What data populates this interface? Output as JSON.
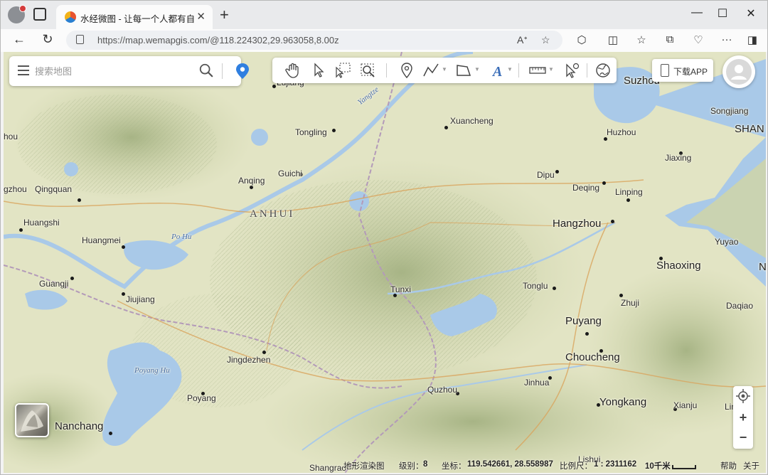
{
  "browser": {
    "tab_title": "水经微图 - 让每一个人都有自己的",
    "url": "https://map.wemapgis.com/@118.224302,29.963058,8.00z"
  },
  "search": {
    "placeholder": "搜索地图"
  },
  "download": {
    "label": "下载APP"
  },
  "map_labels": {
    "places": [
      {
        "name": "Lujiang"
      },
      {
        "name": "Tongling"
      },
      {
        "name": "Xuancheng"
      },
      {
        "name": "Suzhou"
      },
      {
        "name": "Huzhou"
      },
      {
        "name": "Songjiang"
      },
      {
        "name": "SHAN"
      },
      {
        "name": "Jiaxing"
      },
      {
        "name": "Guichi"
      },
      {
        "name": "Anqing"
      },
      {
        "name": "Dipu"
      },
      {
        "name": "Deqing"
      },
      {
        "name": "Linping"
      },
      {
        "name": "Qingquan"
      },
      {
        "name": "gzhou"
      },
      {
        "name": "hou"
      },
      {
        "name": "Huangshi"
      },
      {
        "name": "Huangmei"
      },
      {
        "name": "Hangzhou"
      },
      {
        "name": "Yuyao"
      },
      {
        "name": "Shaoxing"
      },
      {
        "name": "N"
      },
      {
        "name": "Guangji"
      },
      {
        "name": "Tunxi"
      },
      {
        "name": "Tonglu"
      },
      {
        "name": "Jiujiang"
      },
      {
        "name": "Zhuji"
      },
      {
        "name": "Daqiao"
      },
      {
        "name": "Puyang"
      },
      {
        "name": "Jingdezhen"
      },
      {
        "name": "Choucheng"
      },
      {
        "name": "Jinhua"
      },
      {
        "name": "Quzhou"
      },
      {
        "name": "Poyang"
      },
      {
        "name": "Yongkang"
      },
      {
        "name": "Xianju"
      },
      {
        "name": "Linhai"
      },
      {
        "name": "Nanchang"
      },
      {
        "name": "Lishui"
      },
      {
        "name": "Shangrao"
      }
    ],
    "region": "ANHUI",
    "water": [
      "Yangtze",
      "Po Hu",
      "Poyang Hu"
    ]
  },
  "statusbar": {
    "render_label": "地形渲染图",
    "level_label": "级别：",
    "level_value": "8",
    "coord_label": "坐标：",
    "coord_value": "119.542661, 28.558987",
    "scale_label": "比例尺：",
    "scale_value": "1 : 2311162",
    "distance": "10千米",
    "help": "帮助",
    "about": "关于"
  },
  "icons": [
    "menu-icon",
    "search-icon",
    "location-pin-icon",
    "hand-pan-icon",
    "arrow-pointer-icon",
    "select-box-icon",
    "zoom-box-icon",
    "marker-icon",
    "polyline-icon",
    "polygon-icon",
    "text-icon",
    "measure-ruler-icon",
    "identify-pointer-icon",
    "globe-icon",
    "phone-icon",
    "user-avatar-icon",
    "locate-icon",
    "zoom-in-icon",
    "zoom-out-icon",
    "terrain-layer-icon"
  ],
  "colors": {
    "water": "#a9c9e8",
    "land": "#dfe3c0",
    "accent_blue": "#2f7fe0"
  }
}
